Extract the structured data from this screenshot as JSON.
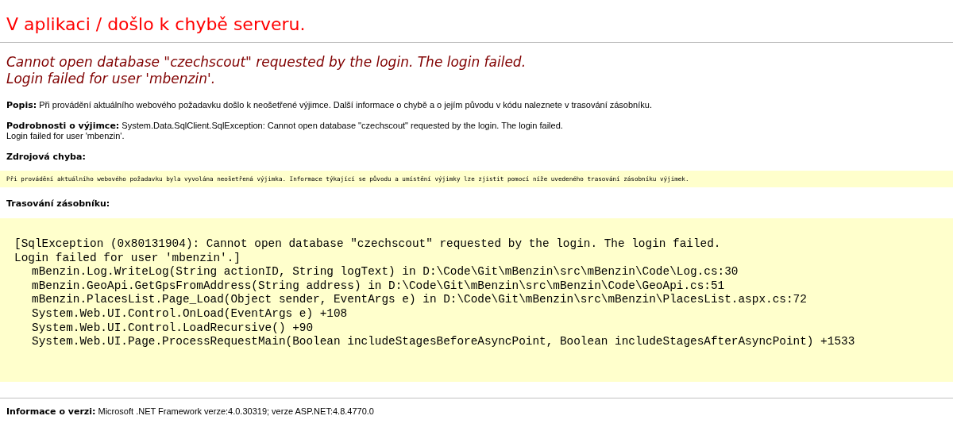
{
  "title": "V aplikaci / došlo k chybě serveru.",
  "error_heading": [
    "Cannot open database \"czechscout\" requested by the login. The login failed.",
    "Login failed for user 'mbenzin'."
  ],
  "description": {
    "label": "Popis:",
    "text": "Při provádění aktuálního webového požadavku došlo k neošetřené výjimce. Další informace o chybě a o jejím původu v kódu naleznete v trasování zásobníku."
  },
  "exception_details": {
    "label": "Podrobnosti o výjimce:",
    "lines": [
      "System.Data.SqlClient.SqlException: Cannot open database \"czechscout\" requested by the login. The login failed.",
      "Login failed for user 'mbenzin'."
    ]
  },
  "source_error": {
    "label": "Zdrojová chyba:",
    "text": "Při provádění aktuálního webového požadavku byla vyvolána neošetřená výjimka. Informace týkající se původu a umístění výjimky lze zjistit pomocí níže uvedeného trasování zásobníku výjimek."
  },
  "stack_trace": {
    "label": "Trasování zásobníku:",
    "exception": [
      "[SqlException (0x80131904): Cannot open database \"czechscout\" requested by the login. The login failed.",
      "Login failed for user 'mbenzin'.]"
    ],
    "frames": [
      "mBenzin.Log.WriteLog(String actionID, String logText) in D:\\Code\\Git\\mBenzin\\src\\mBenzin\\Code\\Log.cs:30",
      "mBenzin.GeoApi.GetGpsFromAddress(String address) in D:\\Code\\Git\\mBenzin\\src\\mBenzin\\Code\\GeoApi.cs:51",
      "mBenzin.PlacesList.Page_Load(Object sender, EventArgs e) in D:\\Code\\Git\\mBenzin\\src\\mBenzin\\PlacesList.aspx.cs:72",
      "System.Web.UI.Control.OnLoad(EventArgs e) +108",
      "System.Web.UI.Control.LoadRecursive() +90",
      "System.Web.UI.Page.ProcessRequestMain(Boolean includeStagesBeforeAsyncPoint, Boolean includeStagesAfterAsyncPoint) +1533"
    ]
  },
  "version": {
    "label": "Informace o verzi:",
    "text": "Microsoft .NET Framework verze:4.0.30319; verze ASP.NET:4.8.4770.0"
  }
}
